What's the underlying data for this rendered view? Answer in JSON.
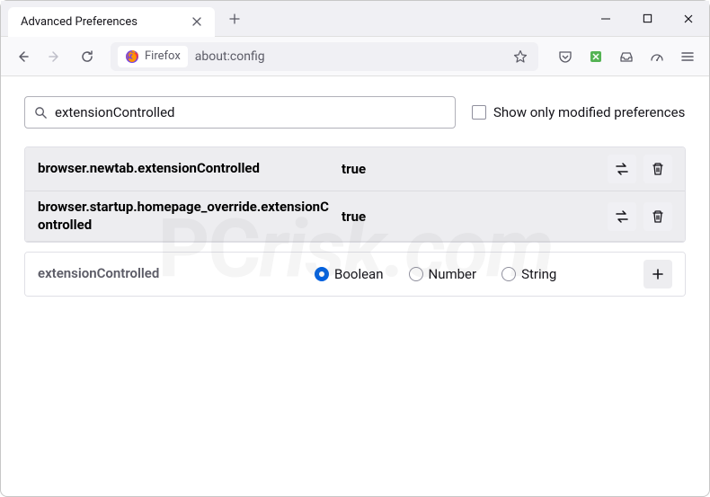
{
  "window": {
    "tab_title": "Advanced Preferences"
  },
  "urlbar": {
    "identity_label": "Firefox",
    "url": "about:config"
  },
  "search": {
    "value": "extensionControlled",
    "checkbox_label": "Show only modified preferences"
  },
  "prefs": [
    {
      "name": "browser.newtab.extensionControlled",
      "value": "true"
    },
    {
      "name": "browser.startup.homepage_override.extensionControlled",
      "value": "true"
    }
  ],
  "new_pref": {
    "name": "extensionControlled",
    "types": [
      "Boolean",
      "Number",
      "String"
    ],
    "selected": "Boolean"
  }
}
